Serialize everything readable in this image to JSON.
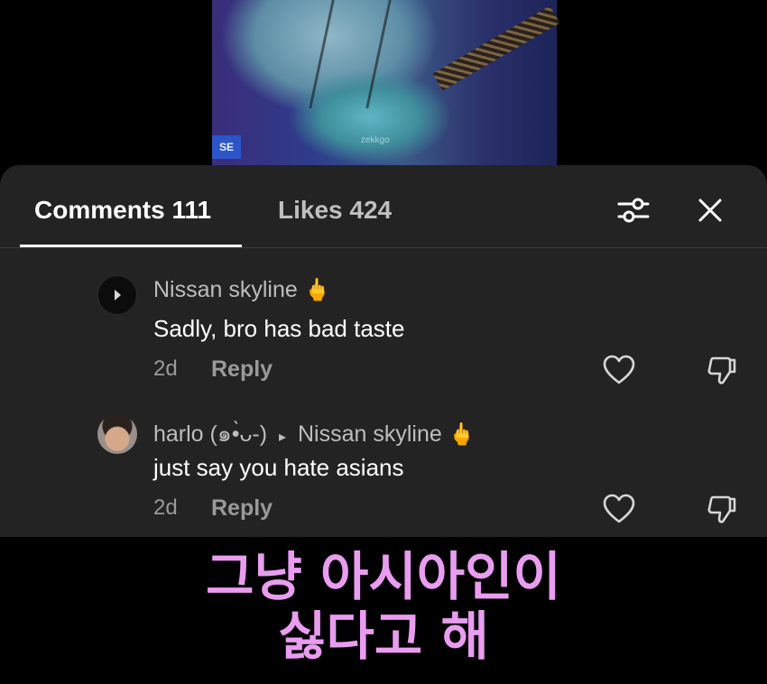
{
  "video": {
    "watermark": "zekkgo",
    "badge": "SE"
  },
  "tabs": {
    "comments": "Comments 111",
    "likes": "Likes 424"
  },
  "comments": [
    {
      "username": "Nissan skyline",
      "emoji": "🖕",
      "text": "Sadly, bro has bad taste",
      "time": "2d",
      "reply": "Reply"
    },
    {
      "username": "harlo (⁠๑⁠•̀⁠ᴗ⁠-⁠)",
      "reply_to": "Nissan skyline",
      "emoji": "🖕",
      "text": "just say you hate asians",
      "time": "2d",
      "reply": "Reply"
    }
  ],
  "caption": {
    "line1": "그냥 아시아인이",
    "line2": "싫다고 해"
  },
  "colors": {
    "panel": "#232323",
    "caption": "#e99cf0"
  }
}
